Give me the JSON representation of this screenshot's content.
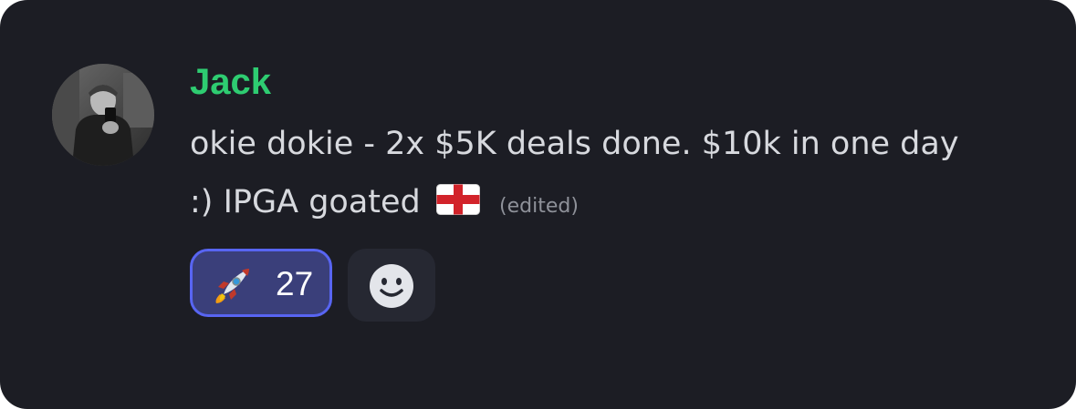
{
  "message": {
    "author": "Jack",
    "author_color": "#2ecc71",
    "text_line1": "okie dokie - 2x $5K deals done. $10k in one day",
    "text_line2": ":) IPGA goated",
    "flag_icon": "england-flag",
    "edited_label": "(edited)"
  },
  "reactions": [
    {
      "emoji": "rocket",
      "count": "27",
      "active": true
    }
  ],
  "add_reaction": {
    "icon": "smiley-face-icon"
  },
  "colors": {
    "background": "#1c1d24",
    "text": "#d7d9de",
    "muted": "#8e9199",
    "reaction_border": "#5865f2",
    "reaction_bg": "#3a3f7a"
  }
}
